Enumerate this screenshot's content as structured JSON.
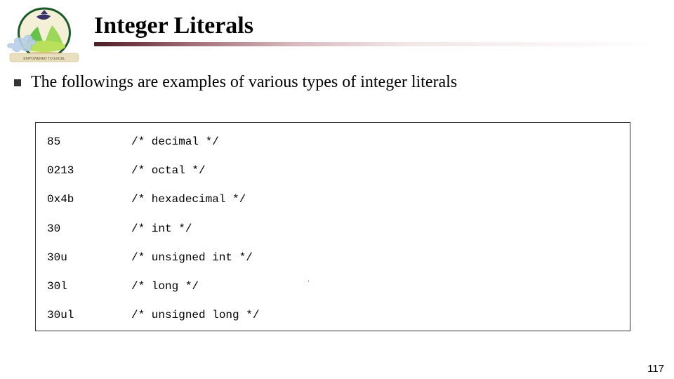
{
  "title": "Integer Literals",
  "bullet": "The followings are examples of various types of integer literals",
  "code": {
    "lines": [
      {
        "literal": "85",
        "comment": "/* decimal */"
      },
      {
        "literal": "0213",
        "comment": "/* octal */"
      },
      {
        "literal": "0x4b",
        "comment": "/* hexadecimal */"
      },
      {
        "literal": "30",
        "comment": "/* int */"
      },
      {
        "literal": "30u",
        "comment": "/* unsigned int */"
      },
      {
        "literal": "30l",
        "comment": "/* long */"
      },
      {
        "literal": "30ul",
        "comment": "/* unsigned long */"
      }
    ]
  },
  "page_number": "117",
  "logo": {
    "name": "mountain-top-university",
    "banner": "EMPOWERED TO EXCEL"
  }
}
